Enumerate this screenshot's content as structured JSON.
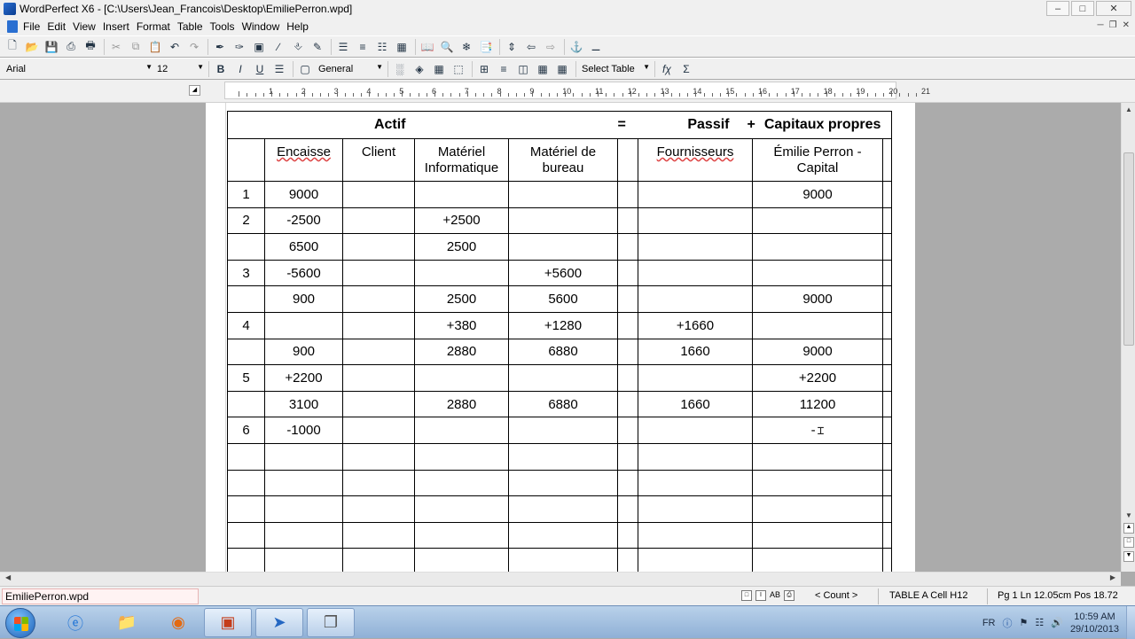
{
  "window": {
    "title": "WordPerfect X6 - [C:\\Users\\Jean_Francois\\Desktop\\EmiliePerron.wpd]",
    "min": "–",
    "max": "□",
    "close": "✕"
  },
  "menu": {
    "items": [
      "File",
      "Edit",
      "View",
      "Insert",
      "Format",
      "Table",
      "Tools",
      "Window",
      "Help"
    ]
  },
  "format_bar": {
    "font": "Arial",
    "size": "12",
    "bold": "B",
    "italic": "I",
    "underline": "U",
    "style": "General",
    "select_table": "Select Table",
    "formula": "fχ",
    "sum": "Σ"
  },
  "ruler": {
    "numbers": [
      "1",
      "2",
      "3",
      "4",
      "5",
      "6",
      "7",
      "8",
      "9",
      "10",
      "11",
      "12",
      "13",
      "14",
      "15",
      "16",
      "17",
      "18",
      "19",
      "20",
      "21"
    ]
  },
  "document": {
    "header": {
      "actif": "Actif",
      "equals": "=",
      "passif": "Passif",
      "plus": "+",
      "capitaux": "Capitaux propres"
    },
    "columns": [
      "",
      "Encaisse",
      "Client",
      "Matériel Informatique",
      "Matériel de bureau",
      "",
      "Fournisseurs",
      "Émilie Perron - Capital",
      ""
    ],
    "rows": [
      [
        "1",
        "9000",
        "",
        "",
        "",
        "",
        "",
        "9000",
        ""
      ],
      [
        "2",
        "-2500",
        "",
        "+2500",
        "",
        "",
        "",
        "",
        ""
      ],
      [
        "",
        "6500",
        "",
        "2500",
        "",
        "",
        "",
        "",
        ""
      ],
      [
        "3",
        "-5600",
        "",
        "",
        "+5600",
        "",
        "",
        "",
        ""
      ],
      [
        "",
        "900",
        "",
        "2500",
        "5600",
        "",
        "",
        "9000",
        ""
      ],
      [
        "4",
        "",
        "",
        "+380",
        "+1280",
        "",
        "+1660",
        "",
        ""
      ],
      [
        "",
        "900",
        "",
        "2880",
        "6880",
        "",
        "1660",
        "9000",
        ""
      ],
      [
        "5",
        "+2200",
        "",
        "",
        "",
        "",
        "",
        "+2200",
        ""
      ],
      [
        "",
        "3100",
        "",
        "2880",
        "6880",
        "",
        "1660",
        "11200",
        ""
      ],
      [
        "6",
        "-1000",
        "",
        "",
        "",
        "",
        "",
        "-",
        ""
      ]
    ],
    "empty_rows": 5
  },
  "status": {
    "doc_tab": "EmiliePerron.wpd",
    "count": "< Count >",
    "cell": "TABLE A Cell  H12",
    "position": "Pg 1 Ln 12.05cm Pos 18.72"
  },
  "taskbar": {
    "lang": "FR",
    "time": "10:59 AM",
    "date": "29/10/2013"
  }
}
